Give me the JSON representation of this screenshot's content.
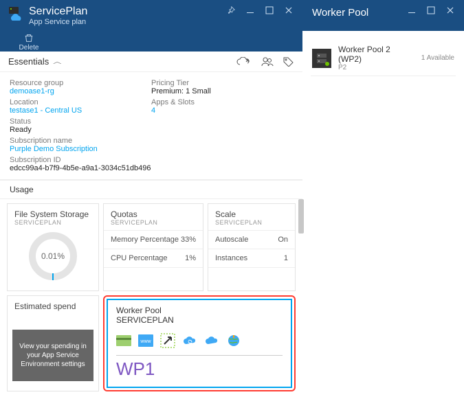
{
  "left": {
    "title": "ServicePlan",
    "subtitle": "App Service plan",
    "delete_label": "Delete",
    "essentials_label": "Essentials",
    "fields": {
      "resource_group_lbl": "Resource group",
      "resource_group_val": "demoase1-rg",
      "location_lbl": "Location",
      "location_val": "testase1 - Central US",
      "status_lbl": "Status",
      "status_val": "Ready",
      "sub_name_lbl": "Subscription name",
      "sub_name_val": "Purple Demo Subscription",
      "sub_id_lbl": "Subscription ID",
      "sub_id_val": "edcc99a4-b7f9-4b5e-a9a1-3034c51db496",
      "pricing_lbl": "Pricing Tier",
      "pricing_val": "Premium: 1 Small",
      "apps_lbl": "Apps & Slots",
      "apps_val": "4"
    },
    "usage_label": "Usage",
    "tiles": {
      "fs_title": "File System Storage",
      "fs_sub": "SERVICEPLAN",
      "fs_value": "0.01%",
      "quotas_title": "Quotas",
      "quotas_sub": "SERVICEPLAN",
      "quotas_rows": [
        {
          "label": "Memory Percentage",
          "value": "33%"
        },
        {
          "label": "CPU Percentage",
          "value": "1%"
        }
      ],
      "scale_title": "Scale",
      "scale_sub": "SERVICEPLAN",
      "scale_rows": [
        {
          "label": "Autoscale",
          "value": "On"
        },
        {
          "label": "Instances",
          "value": "1"
        }
      ],
      "est_title": "Estimated spend",
      "est_text": "View your spending in your App Service Environment settings",
      "wp_title": "Worker Pool",
      "wp_sub": "SERVICEPLAN",
      "wp_value": "WP1"
    }
  },
  "right": {
    "title": "Worker Pool",
    "items": [
      {
        "name": "Worker Pool 2 (WP2)",
        "size": "P2",
        "avail": "1 Available"
      }
    ]
  }
}
